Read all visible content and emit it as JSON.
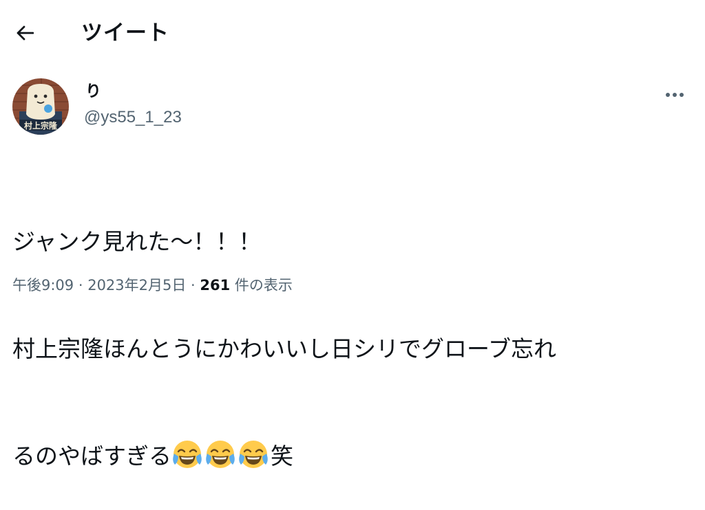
{
  "header": {
    "title": "ツイート",
    "back_icon": "arrow-left-icon"
  },
  "author": {
    "display_name": "り",
    "handle": "@ys55_1_23",
    "avatar_text": "村上宗隆"
  },
  "more_icon": "ellipsis-icon",
  "tweet": {
    "lines": [
      "ジャンク見れた〜！！！",
      "村上宗隆ほんとうにかわいいし日シリでグローブ忘れ",
      "るのやばすぎる"
    ],
    "emoji_name": "face-with-tears-of-joy-icon",
    "emoji_count": 3,
    "trailing_text": "笑"
  },
  "meta": {
    "time": "午後9:09",
    "separator": " · ",
    "date": "2023年2月5日",
    "views_count": "261",
    "views_label": " 件の表示"
  },
  "colors": {
    "text": "#0f1419",
    "secondary": "#536471",
    "background": "#ffffff"
  }
}
